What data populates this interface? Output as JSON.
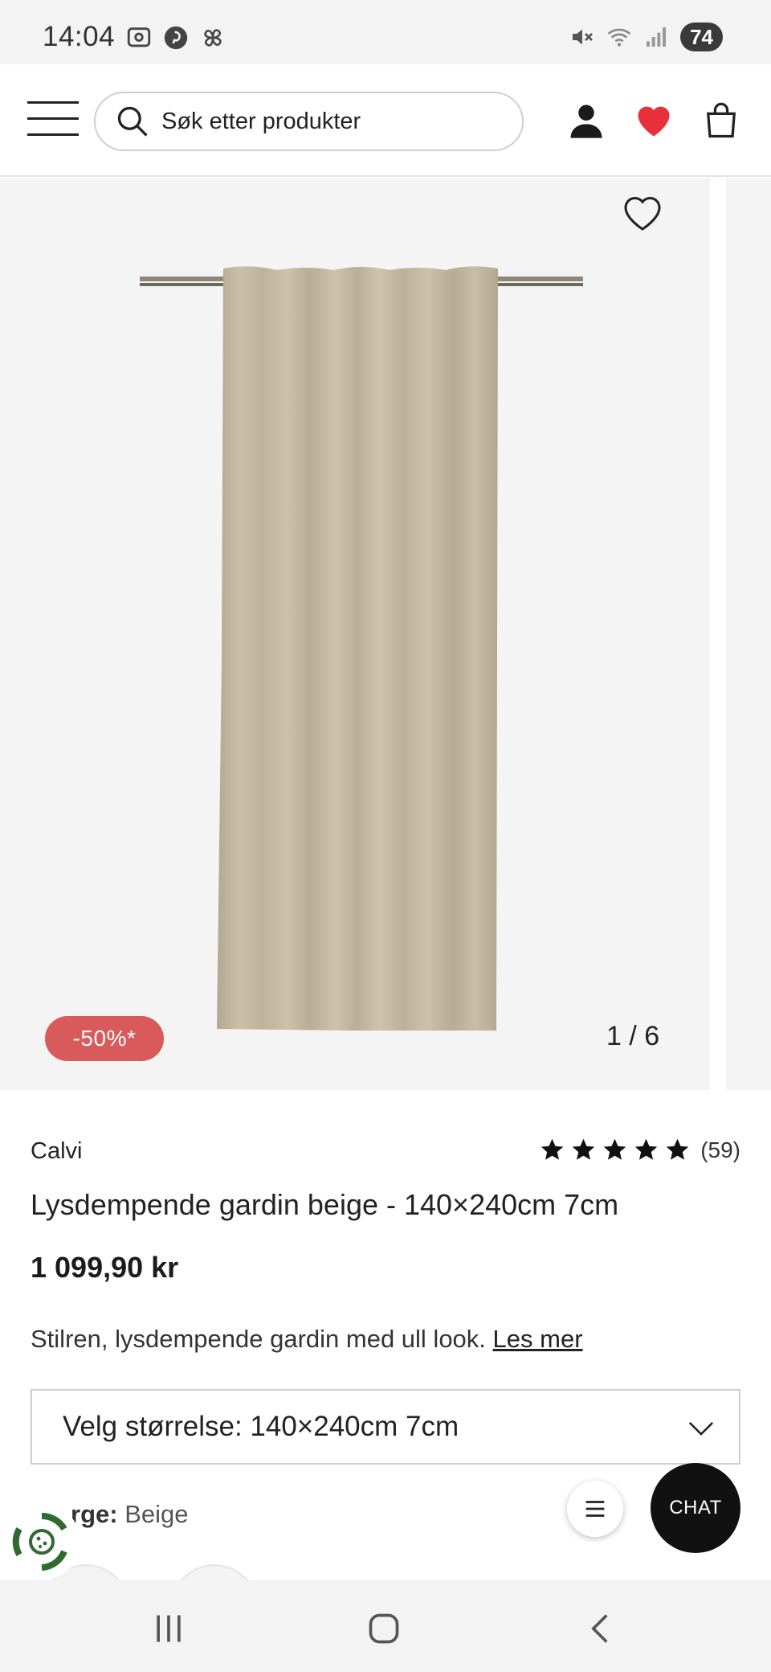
{
  "status_bar": {
    "time": "14:04",
    "battery": "74",
    "icons": [
      "screenshot-icon",
      "pinterest-icon",
      "pinwheel-icon",
      "mute-icon",
      "wifi-icon",
      "signal-icon"
    ]
  },
  "header": {
    "search_placeholder": "Søk etter produkter",
    "icons": [
      "menu-icon",
      "search-icon",
      "user-icon",
      "heart-icon",
      "bag-icon"
    ],
    "heart_color": "#e8303a"
  },
  "gallery": {
    "counter": "1 / 6",
    "discount_badge": "-50%*",
    "badge_color": "#d85a5a"
  },
  "product": {
    "brand": "Calvi",
    "rating_stars": 5,
    "rating_count": "(59)",
    "title": "Lysdempende gardin beige - 140×240cm 7cm",
    "price": "1 099,90 kr",
    "description": "Stilren, lysdempende gardin med ull look.",
    "read_more": "Les mer",
    "size_select": "Velg størrelse: 140×240cm 7cm",
    "color_label": "rge:",
    "color_value": "Beige"
  },
  "floating": {
    "chat_label": "CHAT"
  }
}
